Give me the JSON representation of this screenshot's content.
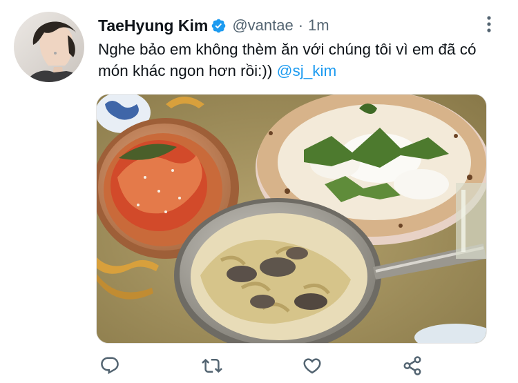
{
  "tweet": {
    "author_name": "TaeHyung Kim",
    "handle": "@vantae",
    "separator": "·",
    "time": "1m",
    "text": "Nghe bảo em không thèm ăn với chúng tôi vì em đã có món khác ngon hơn rồi:)) ",
    "mention": "@sj_kim"
  },
  "icons": {
    "verified": "verified-badge-icon",
    "more": "more-options-icon",
    "reply": "reply-icon",
    "retweet": "retweet-icon",
    "like": "like-icon",
    "share": "share-icon"
  },
  "colors": {
    "accent": "#1d9bf0",
    "text": "#0f1419",
    "secondary": "#536471"
  }
}
